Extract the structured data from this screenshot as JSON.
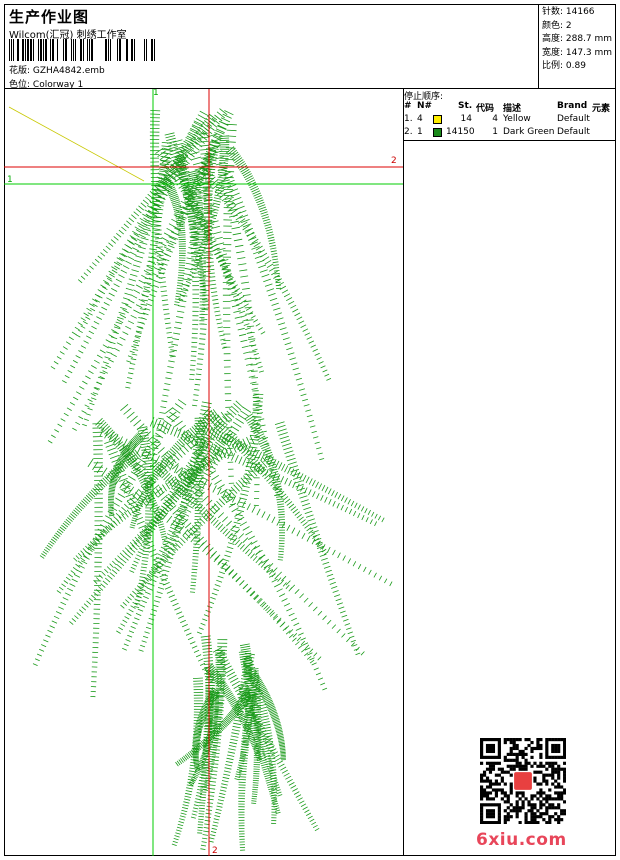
{
  "header": {
    "title": "生产作业图",
    "company": "Wilcom(汇冠) 刺绣工作室",
    "design_label": "花版:",
    "design_value": "GZHA4842.emb",
    "colorway_label": "色位:",
    "colorway_value": "Colorway 1"
  },
  "stats": {
    "stitches": "针数: 14166",
    "colors": "颜色: 2",
    "height": "高度: 288.7 mm",
    "width": "宽度: 147.3 mm",
    "scale": "比例: 0.89"
  },
  "stop_sequence": {
    "title": "停止顺序:",
    "headers": {
      "num": "#",
      "needle": "N#",
      "stitches": "St.",
      "code": "代码",
      "desc": "描述",
      "brand": "Brand",
      "element": "元素"
    },
    "rows": [
      {
        "num": "1.",
        "needle": "4",
        "color": "#ffee00",
        "stitches": "14",
        "code": "4",
        "desc": "Yellow",
        "brand": "Default"
      },
      {
        "num": "2.",
        "needle": "1",
        "color": "#1a8a1a",
        "stitches": "14150",
        "code": "1",
        "desc": "Dark Green",
        "brand": "Default"
      }
    ]
  },
  "axes": {
    "v_green_label": "1",
    "h_green_label": "1",
    "h_red_label": "2",
    "v_red_label": "2"
  },
  "colors": {
    "stitch_green": "#1a9a1a",
    "guide_green": "#00cc00",
    "guide_red": "#dd0000"
  },
  "footer": {
    "brand": "6xiu.com"
  }
}
